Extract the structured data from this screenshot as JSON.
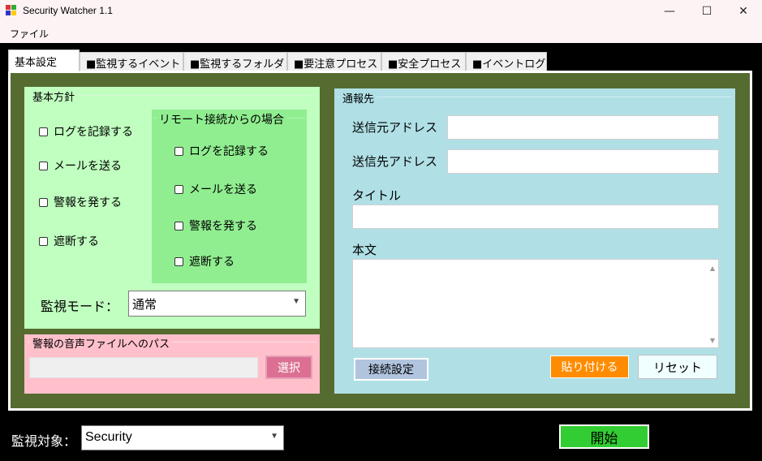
{
  "window": {
    "title": "Security Watcher 1.1",
    "minimize": "—",
    "maximize": "☐",
    "close": "✕"
  },
  "menu": {
    "file": "ファイル"
  },
  "tabs": [
    "基本設定",
    "■監視するイベント",
    "■監視するフォルダ",
    "■要注意プロセス",
    "■安全プロセス",
    "■イベントログ"
  ],
  "basic_policy": {
    "title": "基本方針",
    "options": [
      "ログを記録する",
      "メールを送る",
      "警報を発する",
      "遮断する"
    ],
    "remote": {
      "title": "リモート接続からの場合",
      "options": [
        "ログを記録する",
        "メールを送る",
        "警報を発する",
        "遮断する"
      ]
    },
    "mode_label": "監視モード：",
    "mode_value": "通常"
  },
  "alarm_sound": {
    "title": "警報の音声ファイルへのパス",
    "path_value": "",
    "select_button": "選択"
  },
  "notify": {
    "title": "通報先",
    "from_label": "送信元アドレス",
    "from_value": "",
    "to_label": "送信先アドレス",
    "to_value": "",
    "subject_label": "タイトル",
    "subject_value": "",
    "body_label": "本文",
    "body_value": "",
    "connect_button": "接続設定",
    "paste_button": "貼り付ける",
    "reset_button": "リセット"
  },
  "footer": {
    "target_label": "監視対象：",
    "target_value": "Security",
    "start_button": "開始"
  },
  "colors": {
    "olive": "#566b2f",
    "light_green": "#c0ffc0",
    "mid_green": "#90ee90",
    "pink": "#ffc0cb",
    "light_blue": "#b0e0e6",
    "orange": "#ff8c00",
    "start_green": "#32cd32",
    "select_pink": "#db7093"
  }
}
